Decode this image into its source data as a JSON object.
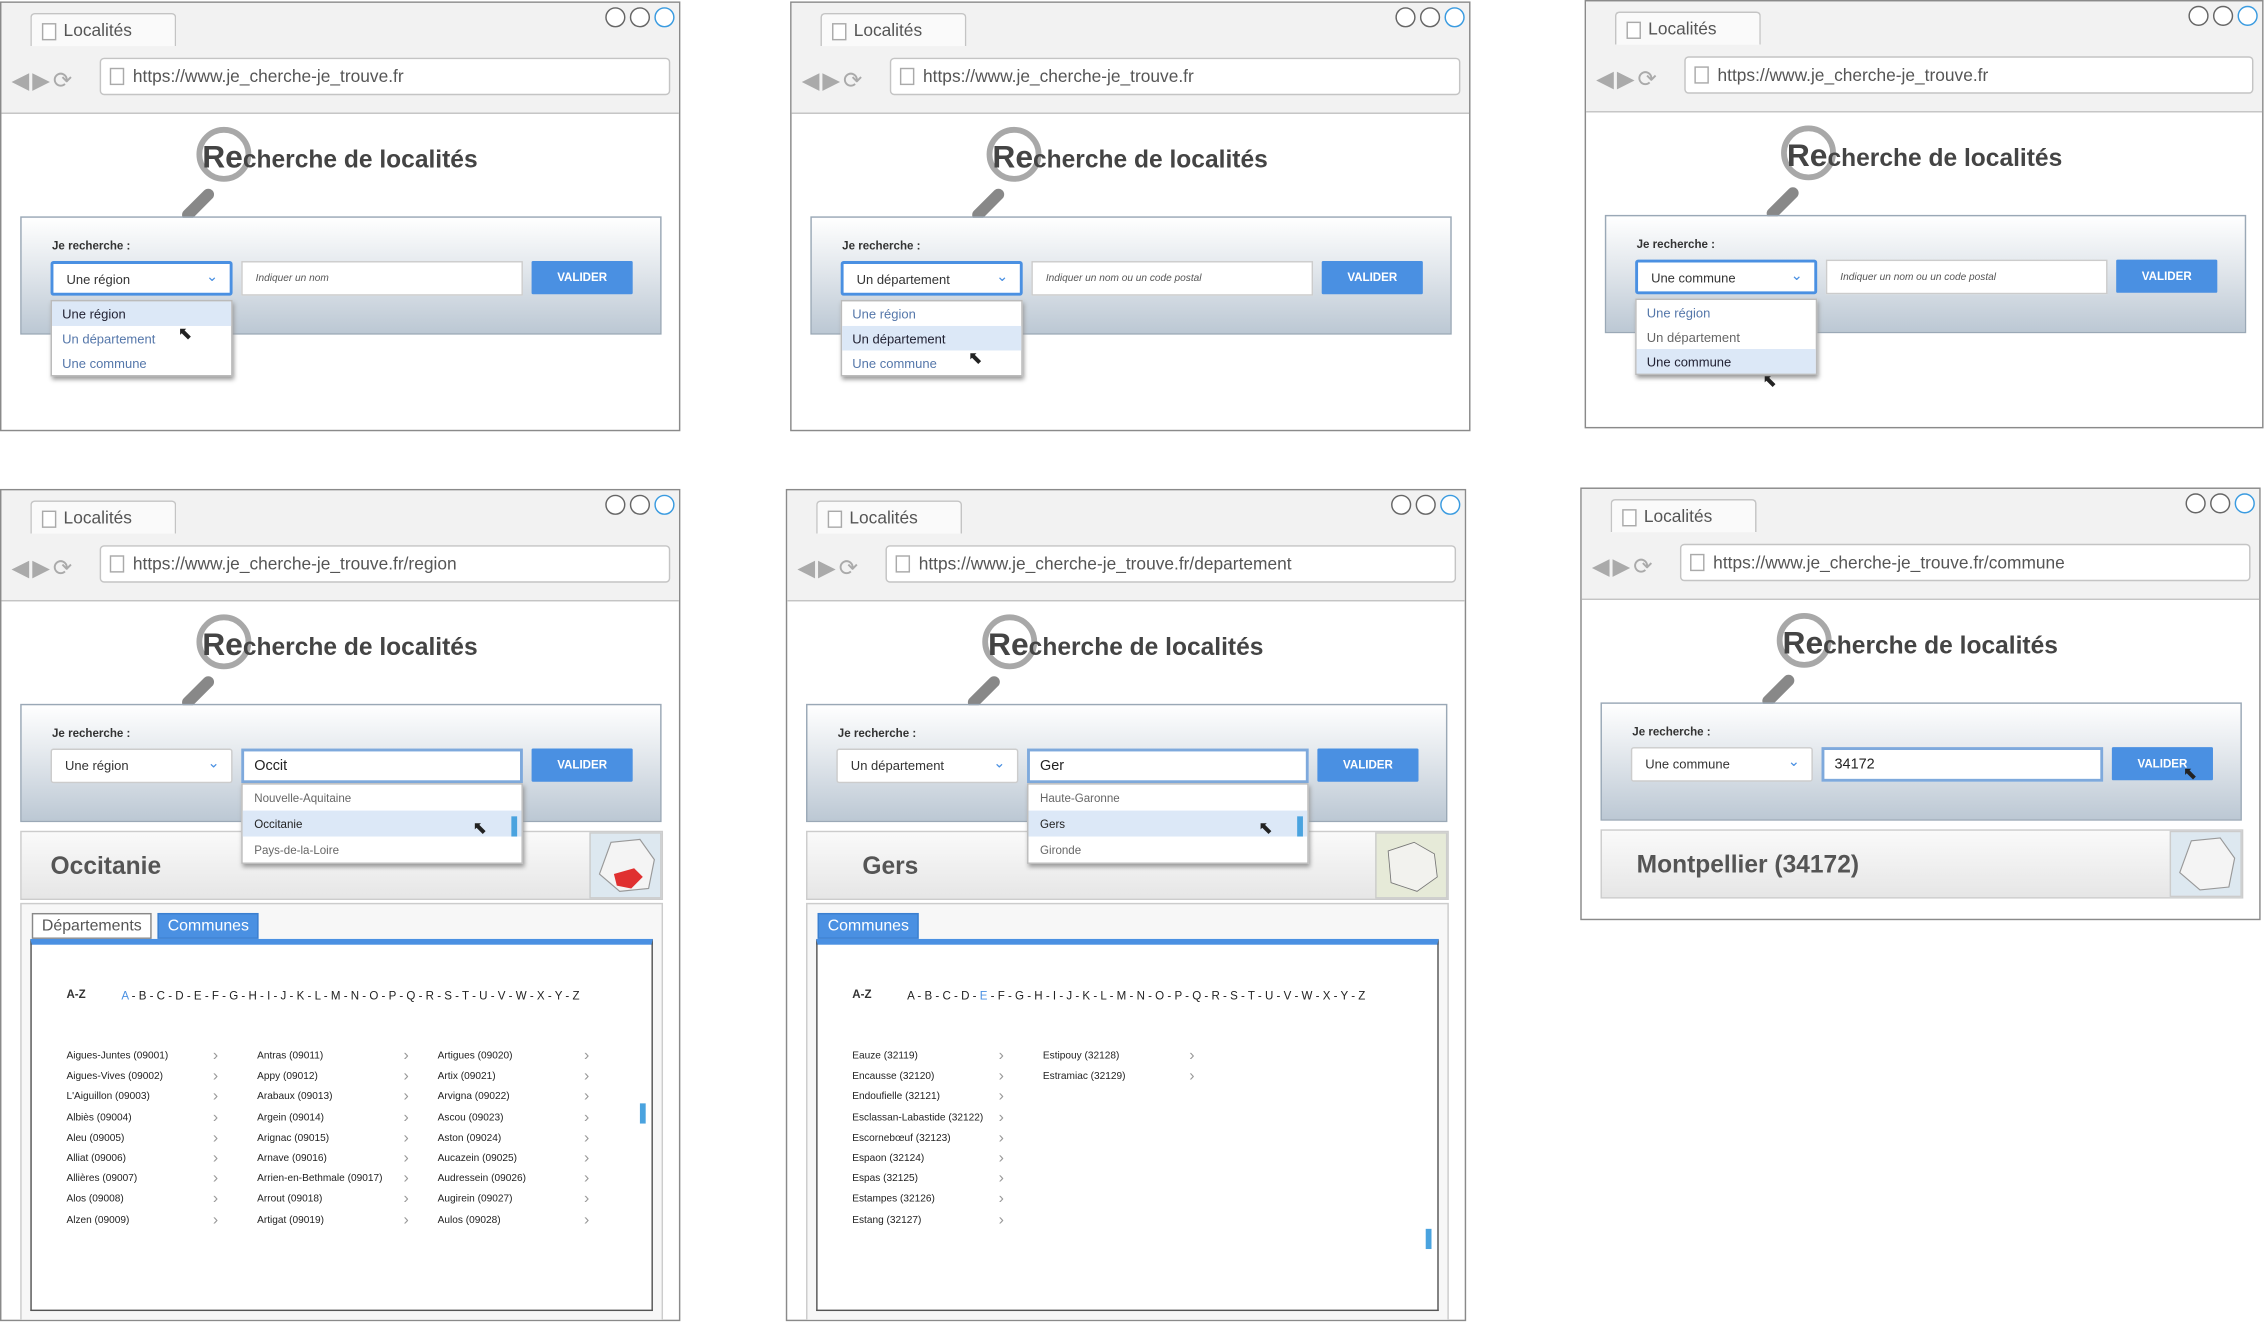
{
  "tab_title": "Localités",
  "page_title_prefix": "Re",
  "page_title_rest": "cherche de localités",
  "search_label": "Je recherche :",
  "validate_label": "VALIDER",
  "type_options": [
    "Une région",
    "Un département",
    "Une commune"
  ],
  "urls": {
    "home": "https://www.je_cherche-je_trouve.fr",
    "region": "https://www.je_cherche-je_trouve.fr/region",
    "departement": "https://www.je_cherche-je_trouve.fr/departement",
    "commune": "https://www.je_cherche-je_trouve.fr/commune"
  },
  "placeholders": {
    "name": "Indiquer un nom",
    "name_or_postal": "Indiquer un nom ou un code postal"
  },
  "screen4": {
    "selected": "Une région",
    "query": "Occit",
    "suggestions": [
      "Nouvelle-Aquitaine",
      "Occitanie",
      "Pays-de-la-Loire"
    ],
    "result": "Occitanie",
    "tabs": [
      "Départements",
      "Communes"
    ],
    "az_label": "A-Z",
    "letters": "A - B - C - D - E - F - G - H - I - J - K - L - M - N - O - P - Q - R - S - T - U - V - W - X - Y - Z",
    "active_letter": "A",
    "communes": [
      [
        "Aigues-Juntes (09001)",
        "Aigues-Vives (09002)",
        "L'Aiguillon (09003)",
        "Albiès (09004)",
        "Aleu (09005)",
        "Alliat (09006)",
        "Allières (09007)",
        "Alos (09008)",
        "Alzen (09009)"
      ],
      [
        "Antras (09011)",
        "Appy (09012)",
        "Arabaux (09013)",
        "Argein (09014)",
        "Arignac (09015)",
        "Arnave (09016)",
        "Arrien-en-Bethmale (09017)",
        "Arrout (09018)",
        "Artigat (09019)"
      ],
      [
        "Artigues (09020)",
        "Artix (09021)",
        "Arvigna (09022)",
        "Ascou (09023)",
        "Aston (09024)",
        "Aucazein (09025)",
        "Audressein (09026)",
        "Augirein (09027)",
        "Aulos (09028)"
      ]
    ]
  },
  "screen5": {
    "selected": "Un département",
    "query": "Ger",
    "suggestions": [
      "Haute-Garonne",
      "Gers",
      "Gironde"
    ],
    "result": "Gers",
    "tabs": [
      "Communes"
    ],
    "az_label": "A-Z",
    "letters": "A - B - C - D - E - F - G - H - I - J - K - L - M - N - O - P - Q - R - S - T - U - V - W - X - Y - Z",
    "active_letter": "E",
    "communes": [
      [
        "Eauze (32119)",
        "Encausse (32120)",
        "Endoufielle (32121)",
        "Esclassan-Labastide (32122)",
        "Escornebœuf (32123)",
        "Espaon (32124)",
        "Espas (32125)",
        "Estampes (32126)",
        "Estang (32127)"
      ],
      [
        "Estipouy (32128)",
        "Estramiac (32129)"
      ]
    ]
  },
  "screen6": {
    "selected": "Une commune",
    "query": "34172",
    "result": "Montpellier (34172)"
  }
}
